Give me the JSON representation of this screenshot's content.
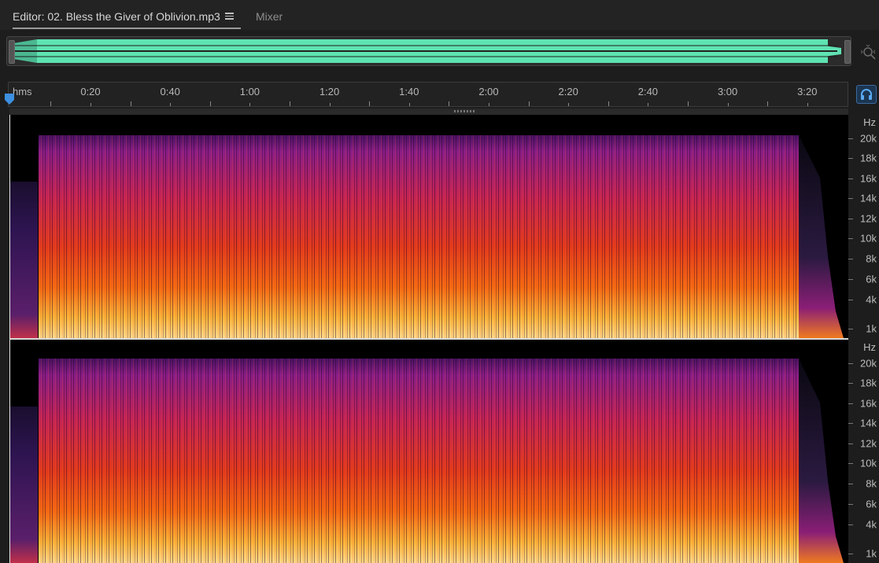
{
  "tabs": {
    "editor_label": "Editor: 02. Bless the Giver of Oblivion.mp3",
    "mixer_label": "Mixer"
  },
  "icons": {
    "menu": "hamburger-menu-icon",
    "zoom": "zoom-navigator-icon",
    "snap": "headphones-icon",
    "playhead": "playhead-marker-icon"
  },
  "colors": {
    "waveform": "#5fe3b2",
    "playhead": "#3d8fe0"
  },
  "ruler": {
    "unit": "hms",
    "labels": [
      "0:20",
      "0:40",
      "1:00",
      "1:20",
      "1:40",
      "2:00",
      "2:20",
      "2:40",
      "3:00",
      "3:20"
    ]
  },
  "freq_scale": {
    "unit": "Hz",
    "labels": [
      "20k",
      "18k",
      "16k",
      "14k",
      "12k",
      "10k",
      "8k",
      "6k",
      "4k",
      "1k"
    ]
  }
}
